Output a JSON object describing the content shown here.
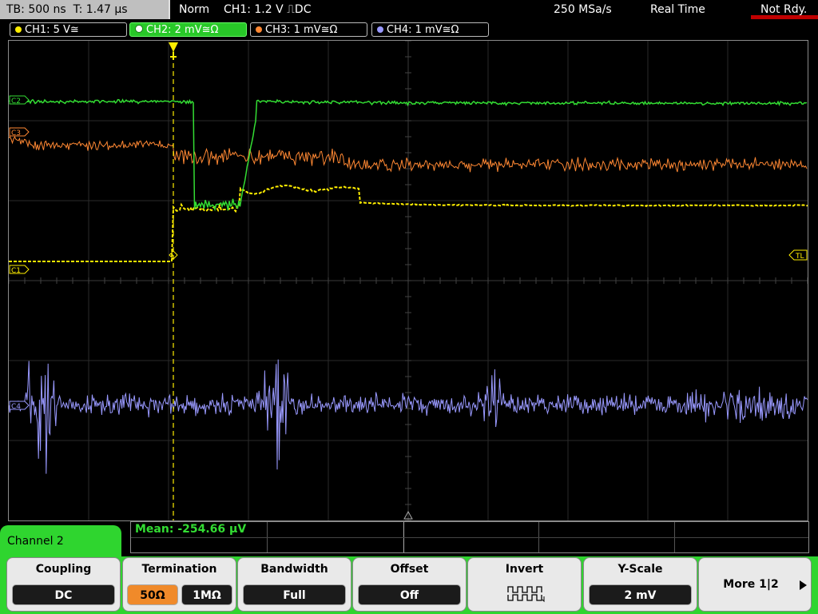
{
  "status": {
    "timebase": "TB: 500 ns",
    "trigger_time": "T: 1.47 µs",
    "mode": "Norm",
    "trigger": "CH1: 1.2 V ⎍DC",
    "sample_rate": "250 MSa/s",
    "acq_mode": "Real Time",
    "ready": "Not Rdy."
  },
  "channels": [
    {
      "label": "CH1: 5 V≅",
      "color": "#ffee00"
    },
    {
      "label": "CH2: 2 mV≅Ω",
      "color": "#33dd33"
    },
    {
      "label": "CH3: 1 mV≅Ω",
      "color": "#ff8833"
    },
    {
      "label": "CH4: 1 mV≅Ω",
      "color": "#9999ff"
    }
  ],
  "markers": {
    "ch1": "C1",
    "ch2": "C2",
    "ch3": "C3",
    "ch4": "C4",
    "trigger_level": "TL"
  },
  "measurement": {
    "mean": "Mean: -254.66 µV"
  },
  "menu": {
    "title": "Channel 2",
    "coupling": {
      "title": "Coupling",
      "value": "DC"
    },
    "termination": {
      "title": "Termination",
      "options": [
        "50Ω",
        "1MΩ"
      ],
      "selected": "50Ω"
    },
    "bandwidth": {
      "title": "Bandwidth",
      "value": "Full"
    },
    "offset": {
      "title": "Offset",
      "value": "Off"
    },
    "invert": {
      "title": "Invert",
      "icon": "invert-waveform-icon"
    },
    "yscale": {
      "title": "Y-Scale",
      "value": "2 mV"
    },
    "more": {
      "title": "More 1|2"
    }
  },
  "colors": {
    "ch1": "#ffee00",
    "ch2": "#33dd33",
    "ch3": "#ff8833",
    "ch4": "#9999ff",
    "accent": "#2fd52f",
    "selected": "#f08a2a"
  }
}
